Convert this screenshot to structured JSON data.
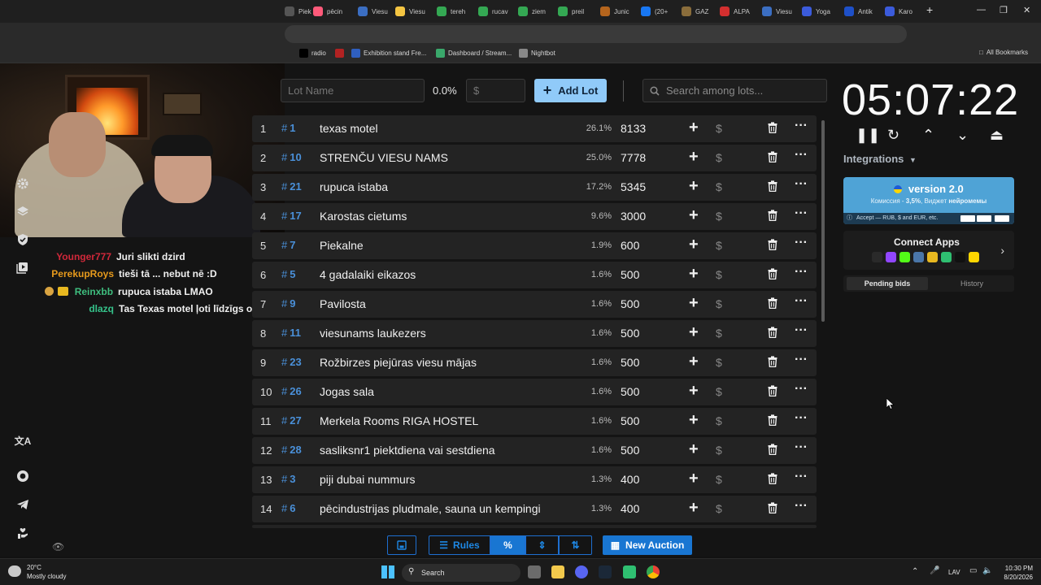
{
  "browser": {
    "tabs": [
      {
        "label": "Piek",
        "color": "#555"
      },
      {
        "label": "pēcin",
        "color": "#ff5a7a"
      },
      {
        "label": "Viesu",
        "color": "#3b6ec2"
      },
      {
        "label": "Viesu",
        "color": "#f4c542"
      },
      {
        "label": "tereh",
        "color": "#34a853"
      },
      {
        "label": "rucav",
        "color": "#34a853"
      },
      {
        "label": "ziem",
        "color": "#34a853"
      },
      {
        "label": "preil",
        "color": "#34a853"
      },
      {
        "label": "Junic",
        "color": "#b5651d"
      },
      {
        "label": "(20+",
        "color": "#1877f2"
      },
      {
        "label": "GAZ",
        "color": "#8a6d3b"
      },
      {
        "label": "ALPA",
        "color": "#d32f2f"
      },
      {
        "label": "Viesu",
        "color": "#3b6ec2"
      },
      {
        "label": "Yoga",
        "color": "#3b5bdb"
      },
      {
        "label": "Antik",
        "color": "#1e50c8"
      },
      {
        "label": "Karo",
        "color": "#3b5bdb"
      }
    ],
    "new_tab": "+",
    "bookmarks": [
      {
        "label": "radio",
        "color": "#000"
      },
      {
        "label": "",
        "color": "#b22222"
      },
      {
        "label": "Exhibition stand Fre...",
        "color": "#2f5fbf"
      },
      {
        "label": "Dashboard / Stream...",
        "color": "#3aa86b"
      },
      {
        "label": "Nightbot",
        "color": "#888"
      }
    ],
    "all_bookmarks": "All Bookmarks"
  },
  "chat": [
    {
      "nick": "Younger777",
      "color": "#d1283a",
      "message": "Juri slikti dzird"
    },
    {
      "nick": "PerekupRoys",
      "color": "#e79a1c",
      "message": "tieši tā ... nebut nē :D"
    },
    {
      "nick": "Reinxbb",
      "color": "#3fbf7f",
      "message": "rupuca istaba LMAO"
    },
    {
      "nick": "dlazq",
      "color": "#35c28a",
      "message": "Tas Texas motel ļoti līdzīgs ofisam"
    }
  ],
  "controls": {
    "lot_name_placeholder": "Lot Name",
    "percent": "0.0%",
    "amount_placeholder": "$",
    "add_lot": "Add Lot",
    "search_placeholder": "Search among lots..."
  },
  "lots": [
    {
      "num": "1",
      "id": "1",
      "name": "texas motel",
      "pct": "26.1%",
      "amount": "8133"
    },
    {
      "num": "2",
      "id": "10",
      "name": "STRENČU VIESU NAMS",
      "pct": "25.0%",
      "amount": "7778"
    },
    {
      "num": "3",
      "id": "21",
      "name": "rupuca istaba",
      "pct": "17.2%",
      "amount": "5345"
    },
    {
      "num": "4",
      "id": "17",
      "name": "Karostas cietums",
      "pct": "9.6%",
      "amount": "3000"
    },
    {
      "num": "5",
      "id": "7",
      "name": "Piekalne",
      "pct": "1.9%",
      "amount": "600"
    },
    {
      "num": "6",
      "id": "5",
      "name": "4 gadalaiki eikazos",
      "pct": "1.6%",
      "amount": "500"
    },
    {
      "num": "7",
      "id": "9",
      "name": "Pavilosta",
      "pct": "1.6%",
      "amount": "500"
    },
    {
      "num": "8",
      "id": "11",
      "name": " viesunams laukezers",
      "pct": "1.6%",
      "amount": "500"
    },
    {
      "num": "9",
      "id": "23",
      "name": "Rožbirzes piejūras viesu mājas",
      "pct": "1.6%",
      "amount": "500"
    },
    {
      "num": "10",
      "id": "26",
      "name": "Jogas sala",
      "pct": "1.6%",
      "amount": "500"
    },
    {
      "num": "11",
      "id": "27",
      "name": " Merkela Rooms RIGA HOSTEL",
      "pct": "1.6%",
      "amount": "500"
    },
    {
      "num": "12",
      "id": "28",
      "name": " sasliksnr1 piektdiena vai sestdiena",
      "pct": "1.6%",
      "amount": "500"
    },
    {
      "num": "13",
      "id": "3",
      "name": "piji dubai nummurs",
      "pct": "1.3%",
      "amount": "400"
    },
    {
      "num": "14",
      "id": "6",
      "name": "pēcindustrijas pludmale, sauna un kempingi",
      "pct": "1.3%",
      "amount": "400"
    }
  ],
  "toolbar": {
    "rules": "Rules",
    "percent_icon": "%",
    "new_auction": "New Auction"
  },
  "timer": "05:07:22",
  "integrations": "Integrations",
  "version_card": {
    "title": "version 2.0",
    "subtitle_pre": "Комиссия - ",
    "subtitle_fee": "3,5%",
    "subtitle_mid": ", Виджет ",
    "subtitle_widget": "нейромемы",
    "accept": "Accept — RUB, $ and EUR, etc."
  },
  "connect_apps": "Connect Apps",
  "bid_tabs": {
    "pending": "Pending bids",
    "history": "History"
  },
  "taskbar": {
    "temp": "20°C",
    "weather": "Mostly cloudy",
    "search": "Search",
    "lang": "LAV",
    "time": "10:30 PM",
    "date": "8/20/2026"
  },
  "colors": {
    "accent": "#90caf9",
    "link": "#4a90d9",
    "primary": "#1976d2"
  }
}
